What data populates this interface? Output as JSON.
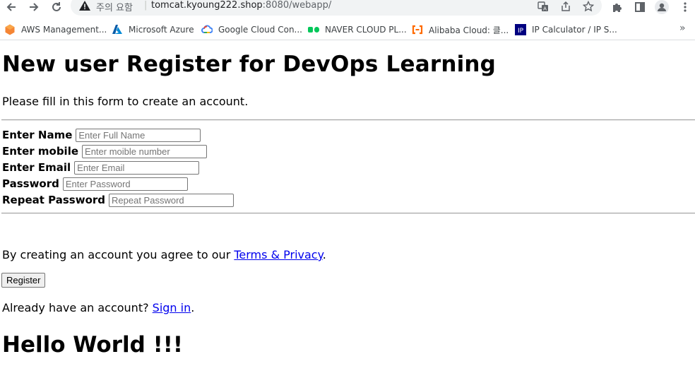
{
  "browser": {
    "security_label": "주의 요함",
    "url_host": "tomcat.kyoung222.shop",
    "url_rest": ":8080/webapp/",
    "icons": {
      "back": "arrow-left-icon",
      "forward": "arrow-right-icon",
      "reload": "reload-icon",
      "warning": "warning-icon",
      "translate": "translate-icon",
      "share": "share-icon",
      "bookmark": "star-icon",
      "extensions": "puzzle-icon",
      "side_panel": "side-panel-icon",
      "profile": "profile-icon",
      "menu": "kebab-menu-icon"
    },
    "bookmarks": [
      {
        "label": "AWS Management...",
        "icon": "aws-icon",
        "color": "#f58534"
      },
      {
        "label": "Microsoft Azure",
        "icon": "azure-icon",
        "color": "#0078d4"
      },
      {
        "label": "Google Cloud Con...",
        "icon": "google-cloud-icon",
        "color": "#4285f4"
      },
      {
        "label": "NAVER CLOUD PL...",
        "icon": "naver-cloud-icon",
        "color": "#03c75a"
      },
      {
        "label": "Alibaba Cloud: 클...",
        "icon": "alibaba-cloud-icon",
        "color": "#ff6a00"
      },
      {
        "label": "IP Calculator / IP S...",
        "icon": "ip-calculator-icon",
        "color": "#000080"
      }
    ],
    "bookmarks_more": "»"
  },
  "page": {
    "title": "New user Register for DevOps Learning",
    "intro": "Please fill in this form to create an account.",
    "fields": [
      {
        "label": "Enter Name",
        "placeholder": "Enter Full Name",
        "value": ""
      },
      {
        "label": "Enter mobile",
        "placeholder": "Enter moible number",
        "value": ""
      },
      {
        "label": "Enter Email",
        "placeholder": "Enter Email",
        "value": ""
      },
      {
        "label": "Password",
        "placeholder": "Enter Password",
        "value": ""
      },
      {
        "label": "Repeat Password",
        "placeholder": "Repeat Password",
        "value": ""
      }
    ],
    "agree_prefix": "By creating an account you agree to our ",
    "agree_link": "Terms & Privacy",
    "agree_suffix": ".",
    "register_label": "Register",
    "signin_prefix": "Already have an account? ",
    "signin_link": "Sign in",
    "signin_suffix": ".",
    "hello": "Hello World !!!"
  }
}
